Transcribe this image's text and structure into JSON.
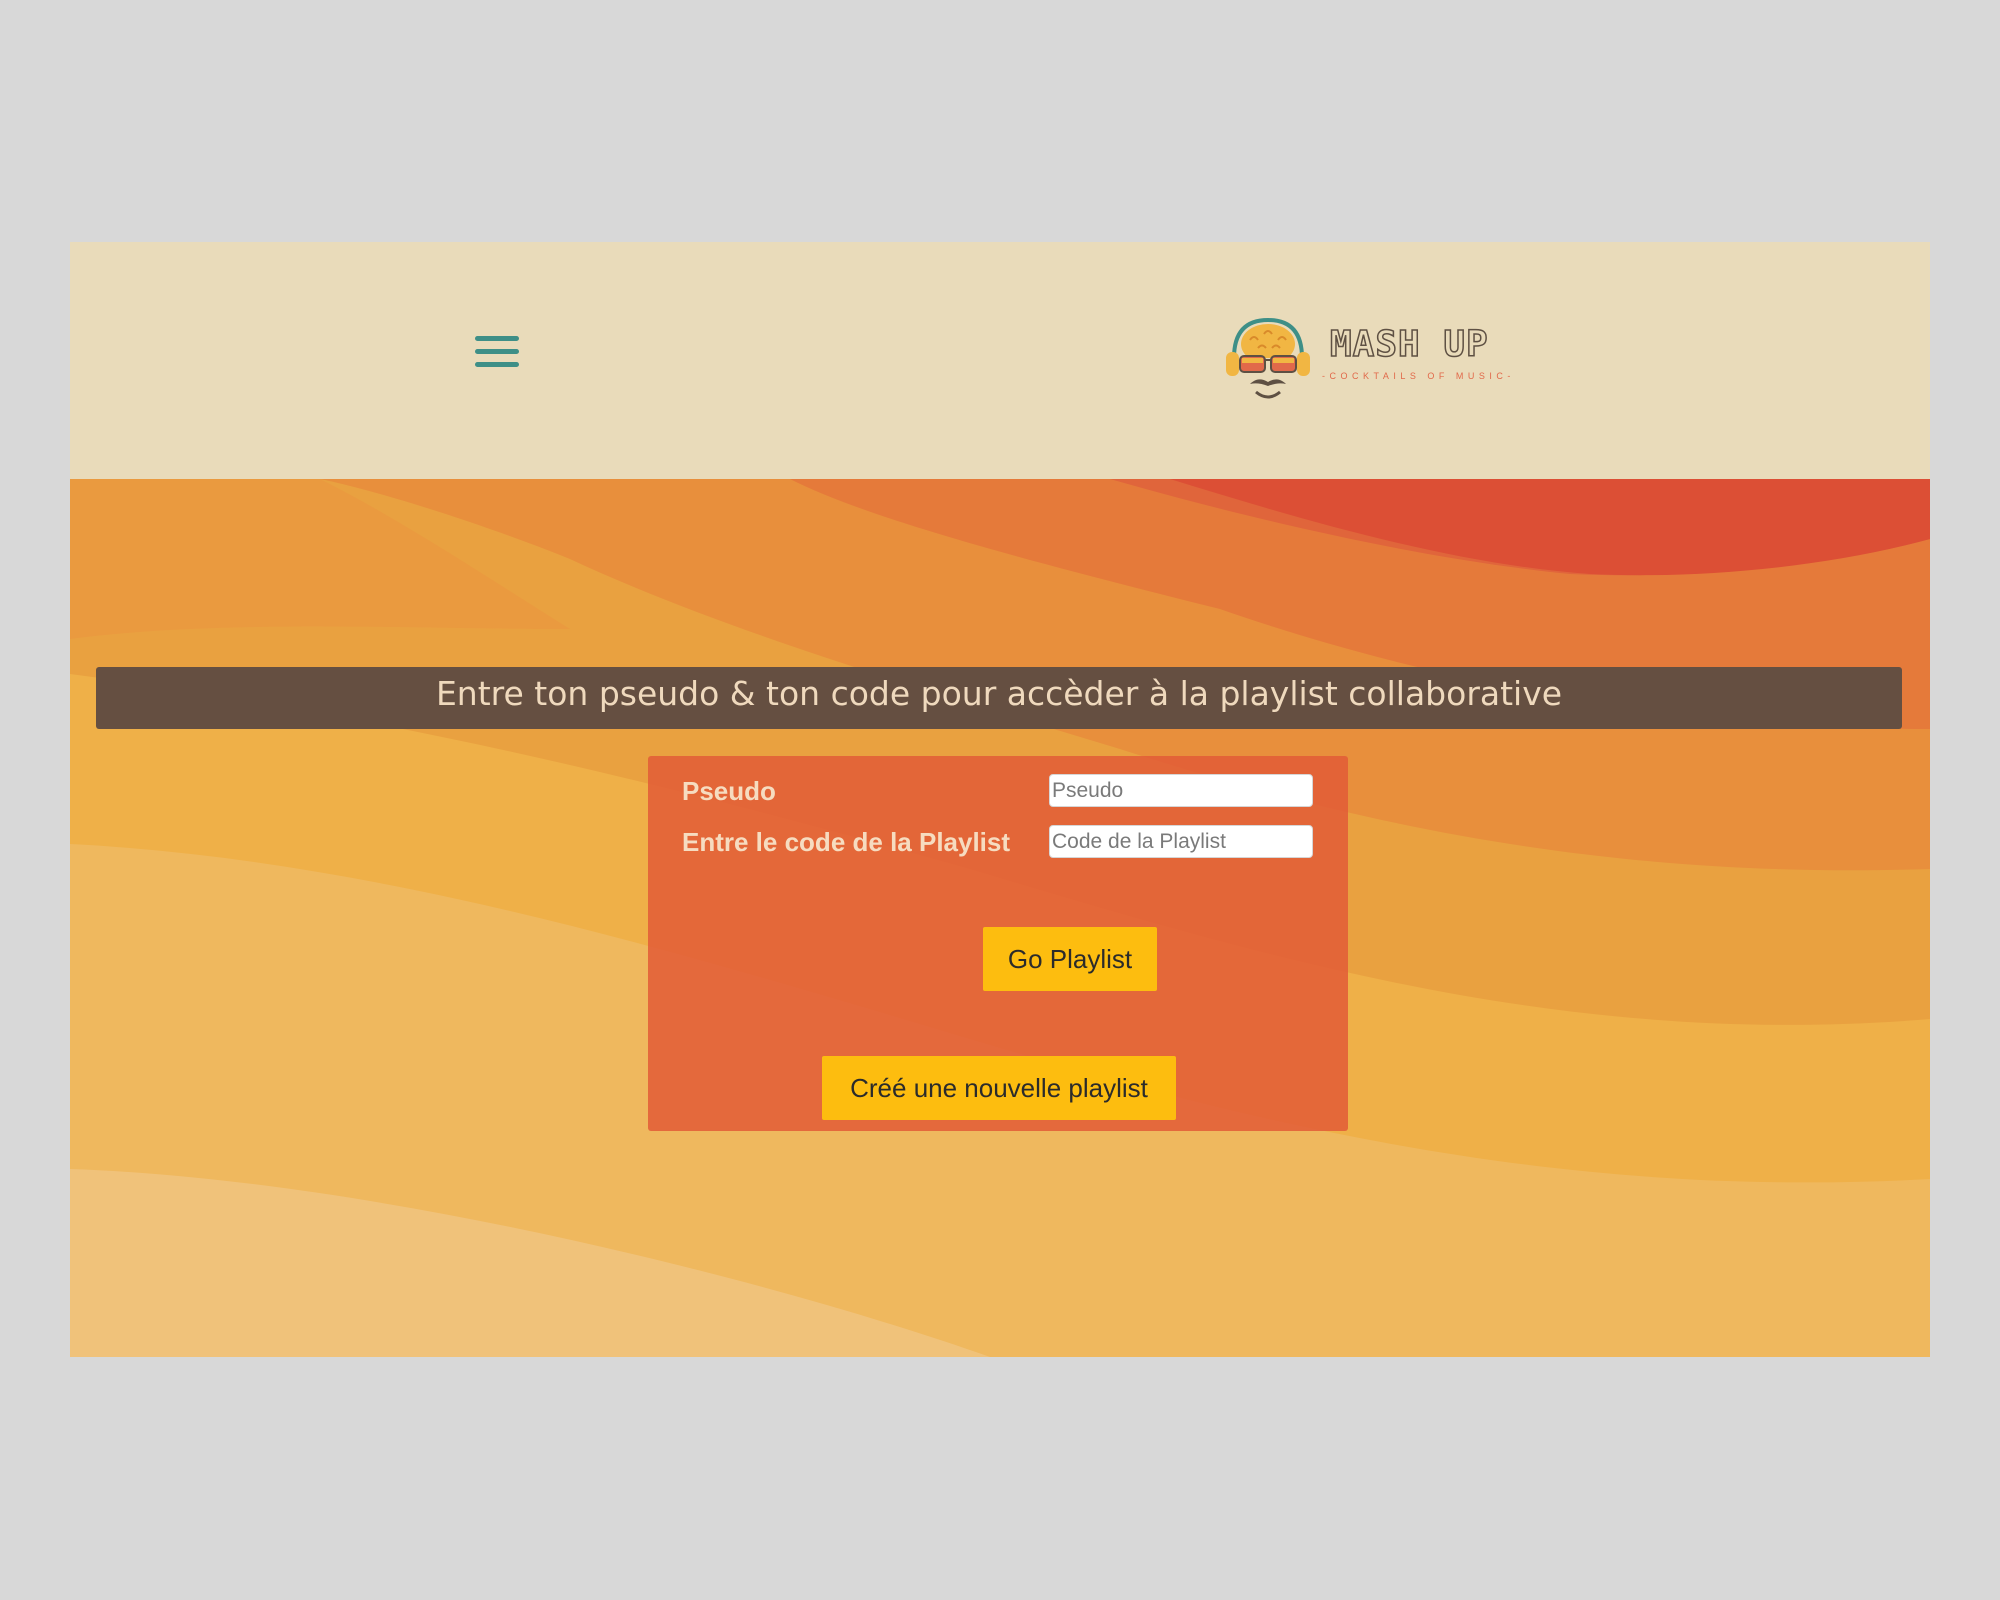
{
  "header": {
    "menu_icon": "hamburger-menu-icon",
    "logo": {
      "title": "MASH UP",
      "tagline": "-COCKTAILS OF MUSIC-",
      "icon": "dj-headphones-mustache-icon"
    }
  },
  "banner": {
    "text": "Entre ton pseudo & ton code pour accèder à la playlist collaborative"
  },
  "form": {
    "pseudo_label": "Pseudo",
    "pseudo_placeholder": "Pseudo",
    "pseudo_value": "",
    "code_label": "Entre le code de la Playlist",
    "code_placeholder": "Code de la Playlist",
    "code_value": "",
    "go_button": "Go Playlist",
    "new_button": "Créé une nouvelle playlist"
  },
  "colors": {
    "header_bg": "#e9dbba",
    "banner_bg": "#654f41",
    "card_bg": "#e25c37",
    "button_bg": "#fdbd0f",
    "menu_icon": "#3e8f87"
  }
}
